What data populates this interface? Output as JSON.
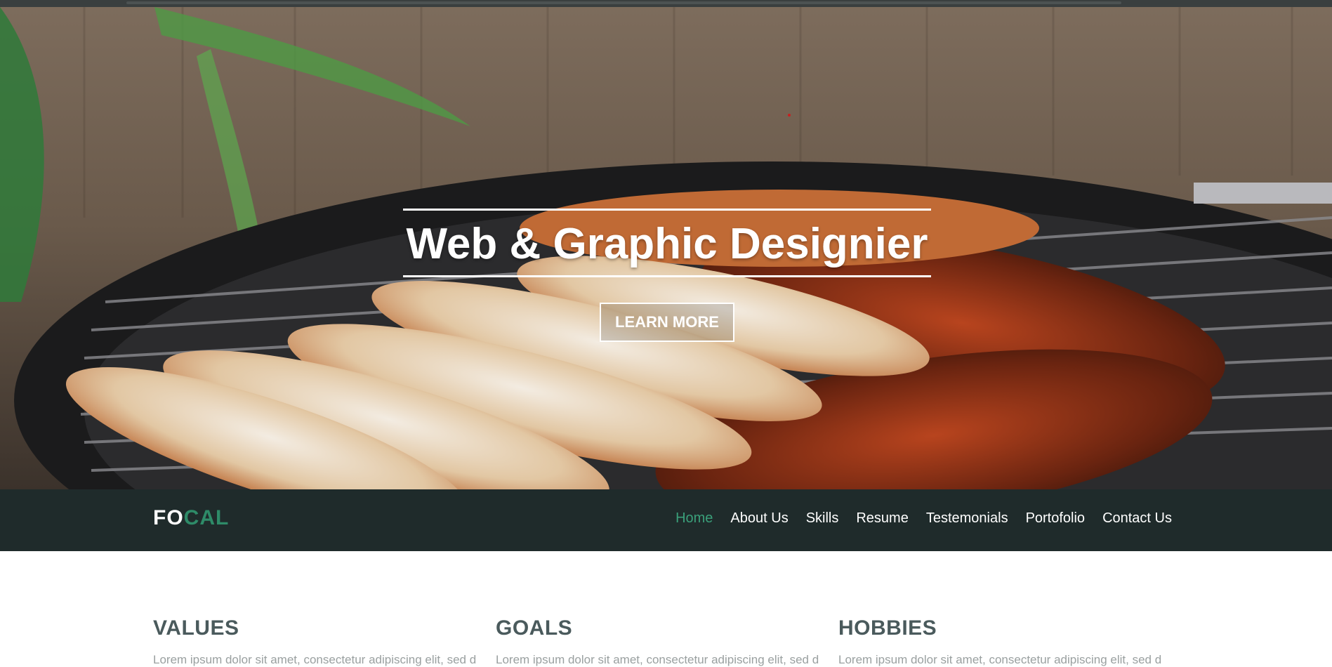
{
  "hero": {
    "title": "Web & Graphic Designier",
    "button_label": "LEARN MORE"
  },
  "nav": {
    "logo_part1": "FO",
    "logo_part2": "CAL",
    "links": [
      {
        "label": "Home",
        "active": true
      },
      {
        "label": "About Us",
        "active": false
      },
      {
        "label": "Skills",
        "active": false
      },
      {
        "label": "Resume",
        "active": false
      },
      {
        "label": "Testemonials",
        "active": false
      },
      {
        "label": "Portofolio",
        "active": false
      },
      {
        "label": "Contact Us",
        "active": false
      }
    ]
  },
  "sections": [
    {
      "heading": "VALUES",
      "text": "Lorem ipsum dolor sit amet, consectetur adipiscing elit, sed do eiusmod"
    },
    {
      "heading": "GOALS",
      "text": "Lorem ipsum dolor sit amet, consectetur adipiscing elit, sed do eiusmod"
    },
    {
      "heading": "HOBBIES",
      "text": "Lorem ipsum dolor sit amet, consectetur adipiscing elit, sed do eiusmod"
    }
  ],
  "colors": {
    "navbar_bg": "#1f2b2b",
    "accent": "#2e8b68",
    "heading": "#4a5a5c"
  }
}
